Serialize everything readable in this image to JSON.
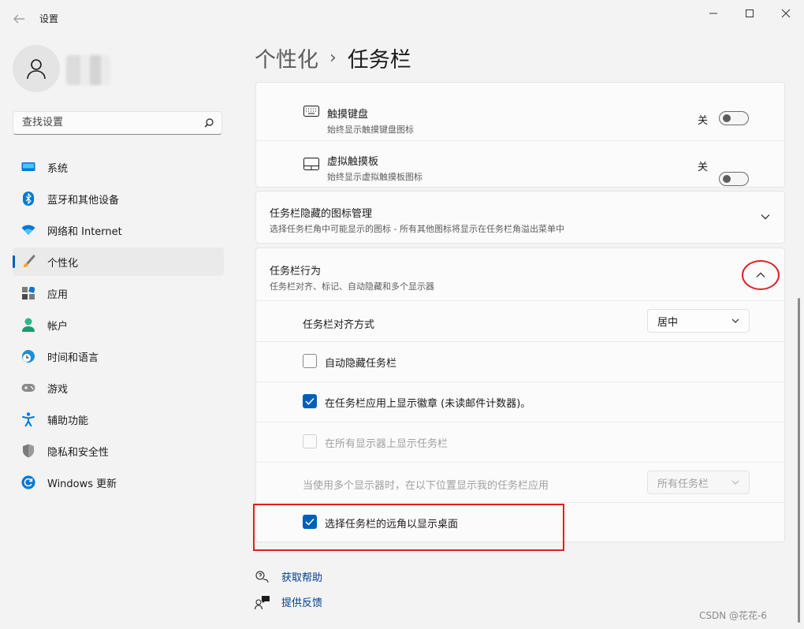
{
  "window": {
    "title": "设置"
  },
  "user": {
    "name": ""
  },
  "search": {
    "placeholder": "查找设置"
  },
  "nav": {
    "items": [
      {
        "label": "系统",
        "icon": "system-icon"
      },
      {
        "label": "蓝牙和其他设备",
        "icon": "bluetooth-icon"
      },
      {
        "label": "网络和 Internet",
        "icon": "network-icon"
      },
      {
        "label": "个性化",
        "icon": "brush-icon",
        "active": true
      },
      {
        "label": "应用",
        "icon": "apps-icon"
      },
      {
        "label": "帐户",
        "icon": "account-icon"
      },
      {
        "label": "时间和语言",
        "icon": "time-language-icon"
      },
      {
        "label": "游戏",
        "icon": "gaming-icon"
      },
      {
        "label": "辅助功能",
        "icon": "accessibility-icon"
      },
      {
        "label": "隐私和安全性",
        "icon": "shield-icon"
      },
      {
        "label": "Windows 更新",
        "icon": "update-icon"
      }
    ]
  },
  "header": {
    "parent": "个性化",
    "separator": "›",
    "current": "任务栏"
  },
  "pen_items": {
    "touch_keyboard": {
      "title": "触摸键盘",
      "subtitle": "始终显示触摸键盘图标",
      "state": "关",
      "on": false
    },
    "touchpad": {
      "title": "虚拟触摸板",
      "subtitle": "始终显示虚拟触摸板图标",
      "state": "关",
      "on": false
    }
  },
  "overflow": {
    "title": "任务栏隐藏的图标管理",
    "subtitle": "选择任务栏角中可能显示的图标 - 所有其他图标将显示在任务栏角溢出菜单中"
  },
  "behaviors": {
    "title": "任务栏行为",
    "subtitle": "任务栏对齐、标记、自动隐藏和多个显示器",
    "alignment_label": "任务栏对齐方式",
    "alignment_value": "居中",
    "auto_hide": {
      "label": "自动隐藏任务栏",
      "checked": false
    },
    "badges": {
      "label": "在任务栏应用上显示徽章 (未读邮件计数器)。",
      "checked": true
    },
    "all_displays": {
      "label": "在所有显示器上显示任务栏",
      "checked": false,
      "disabled": true
    },
    "multi_display_label": "当使用多个显示器时，在以下位置显示我的任务栏应用",
    "multi_display_value": "所有任务栏",
    "far_corner": {
      "label": "选择任务栏的远角以显示桌面",
      "checked": true
    }
  },
  "footer": {
    "help": "获取帮助",
    "feedback": "提供反馈"
  },
  "watermark": "CSDN @花花-6",
  "colors": {
    "accent": "#005fb8",
    "annotation": "#e02020",
    "link": "#003e92"
  }
}
